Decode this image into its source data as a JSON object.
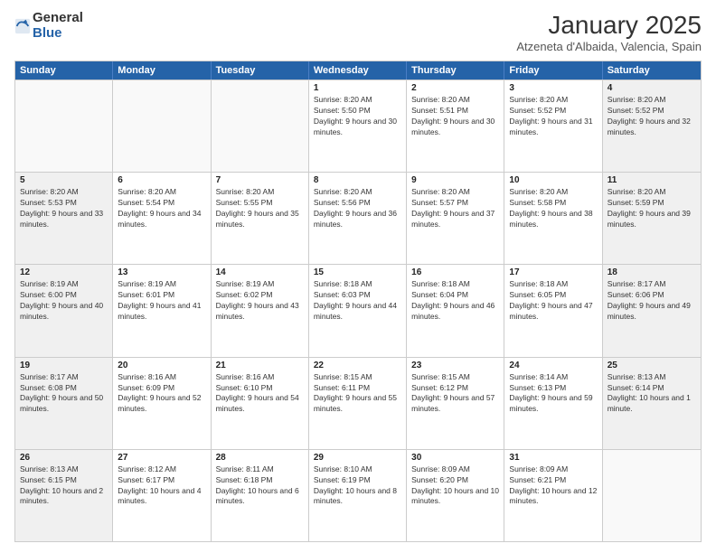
{
  "header": {
    "logo": {
      "general": "General",
      "blue": "Blue"
    },
    "title": "January 2025",
    "subtitle": "Atzeneta d'Albaida, Valencia, Spain"
  },
  "weekdays": [
    "Sunday",
    "Monday",
    "Tuesday",
    "Wednesday",
    "Thursday",
    "Friday",
    "Saturday"
  ],
  "weeks": [
    [
      {
        "day": "",
        "empty": true
      },
      {
        "day": "",
        "empty": true
      },
      {
        "day": "",
        "empty": true
      },
      {
        "day": "1",
        "sunrise": "8:20 AM",
        "sunset": "5:50 PM",
        "daylight": "9 hours and 30 minutes."
      },
      {
        "day": "2",
        "sunrise": "8:20 AM",
        "sunset": "5:51 PM",
        "daylight": "9 hours and 30 minutes."
      },
      {
        "day": "3",
        "sunrise": "8:20 AM",
        "sunset": "5:52 PM",
        "daylight": "9 hours and 31 minutes."
      },
      {
        "day": "4",
        "sunrise": "8:20 AM",
        "sunset": "5:52 PM",
        "daylight": "9 hours and 32 minutes."
      }
    ],
    [
      {
        "day": "5",
        "sunrise": "8:20 AM",
        "sunset": "5:53 PM",
        "daylight": "9 hours and 33 minutes."
      },
      {
        "day": "6",
        "sunrise": "8:20 AM",
        "sunset": "5:54 PM",
        "daylight": "9 hours and 34 minutes."
      },
      {
        "day": "7",
        "sunrise": "8:20 AM",
        "sunset": "5:55 PM",
        "daylight": "9 hours and 35 minutes."
      },
      {
        "day": "8",
        "sunrise": "8:20 AM",
        "sunset": "5:56 PM",
        "daylight": "9 hours and 36 minutes."
      },
      {
        "day": "9",
        "sunrise": "8:20 AM",
        "sunset": "5:57 PM",
        "daylight": "9 hours and 37 minutes."
      },
      {
        "day": "10",
        "sunrise": "8:20 AM",
        "sunset": "5:58 PM",
        "daylight": "9 hours and 38 minutes."
      },
      {
        "day": "11",
        "sunrise": "8:20 AM",
        "sunset": "5:59 PM",
        "daylight": "9 hours and 39 minutes."
      }
    ],
    [
      {
        "day": "12",
        "sunrise": "8:19 AM",
        "sunset": "6:00 PM",
        "daylight": "9 hours and 40 minutes."
      },
      {
        "day": "13",
        "sunrise": "8:19 AM",
        "sunset": "6:01 PM",
        "daylight": "9 hours and 41 minutes."
      },
      {
        "day": "14",
        "sunrise": "8:19 AM",
        "sunset": "6:02 PM",
        "daylight": "9 hours and 43 minutes."
      },
      {
        "day": "15",
        "sunrise": "8:18 AM",
        "sunset": "6:03 PM",
        "daylight": "9 hours and 44 minutes."
      },
      {
        "day": "16",
        "sunrise": "8:18 AM",
        "sunset": "6:04 PM",
        "daylight": "9 hours and 46 minutes."
      },
      {
        "day": "17",
        "sunrise": "8:18 AM",
        "sunset": "6:05 PM",
        "daylight": "9 hours and 47 minutes."
      },
      {
        "day": "18",
        "sunrise": "8:17 AM",
        "sunset": "6:06 PM",
        "daylight": "9 hours and 49 minutes."
      }
    ],
    [
      {
        "day": "19",
        "sunrise": "8:17 AM",
        "sunset": "6:08 PM",
        "daylight": "9 hours and 50 minutes."
      },
      {
        "day": "20",
        "sunrise": "8:16 AM",
        "sunset": "6:09 PM",
        "daylight": "9 hours and 52 minutes."
      },
      {
        "day": "21",
        "sunrise": "8:16 AM",
        "sunset": "6:10 PM",
        "daylight": "9 hours and 54 minutes."
      },
      {
        "day": "22",
        "sunrise": "8:15 AM",
        "sunset": "6:11 PM",
        "daylight": "9 hours and 55 minutes."
      },
      {
        "day": "23",
        "sunrise": "8:15 AM",
        "sunset": "6:12 PM",
        "daylight": "9 hours and 57 minutes."
      },
      {
        "day": "24",
        "sunrise": "8:14 AM",
        "sunset": "6:13 PM",
        "daylight": "9 hours and 59 minutes."
      },
      {
        "day": "25",
        "sunrise": "8:13 AM",
        "sunset": "6:14 PM",
        "daylight": "10 hours and 1 minute."
      }
    ],
    [
      {
        "day": "26",
        "sunrise": "8:13 AM",
        "sunset": "6:15 PM",
        "daylight": "10 hours and 2 minutes."
      },
      {
        "day": "27",
        "sunrise": "8:12 AM",
        "sunset": "6:17 PM",
        "daylight": "10 hours and 4 minutes."
      },
      {
        "day": "28",
        "sunrise": "8:11 AM",
        "sunset": "6:18 PM",
        "daylight": "10 hours and 6 minutes."
      },
      {
        "day": "29",
        "sunrise": "8:10 AM",
        "sunset": "6:19 PM",
        "daylight": "10 hours and 8 minutes."
      },
      {
        "day": "30",
        "sunrise": "8:09 AM",
        "sunset": "6:20 PM",
        "daylight": "10 hours and 10 minutes."
      },
      {
        "day": "31",
        "sunrise": "8:09 AM",
        "sunset": "6:21 PM",
        "daylight": "10 hours and 12 minutes."
      },
      {
        "day": "",
        "empty": true
      }
    ]
  ],
  "labels": {
    "sunrise": "Sunrise:",
    "sunset": "Sunset:",
    "daylight": "Daylight:"
  }
}
